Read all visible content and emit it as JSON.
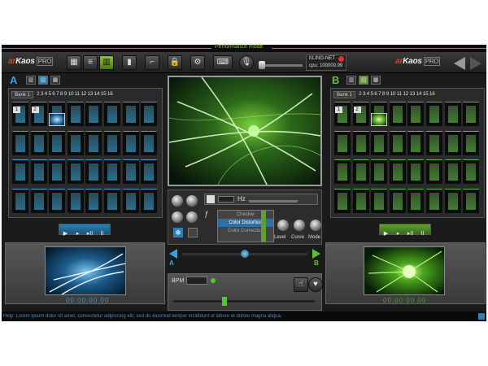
{
  "mode_label": "Performance mode",
  "brand": {
    "ar": "ar",
    "kaos": "Kaos",
    "pro": "PRO"
  },
  "kling": {
    "title": "KLING-NET",
    "cpu": "cpu: 100000.99"
  },
  "deck_a": {
    "letter": "A",
    "bank": "Bank 1",
    "bank_numbers": "2 3 4 5 6 7 8 9 10 11 12 13 14 15 16",
    "cell_numbers": [
      "1",
      "2"
    ],
    "timecode": "00:00:00.00",
    "accent": "#2aa7df"
  },
  "deck_b": {
    "letter": "B",
    "bank": "Bank 1",
    "bank_numbers": "2 3 4 5 6 7 8 9 10 11 12 13 14 15 16",
    "cell_numbers": [
      "1",
      "2"
    ],
    "timecode": "00:00:00.00",
    "accent": "#56c338"
  },
  "fx": {
    "hz_label": "Hz",
    "filters": [
      "Checker",
      "Color Distortion",
      "Color Correction"
    ],
    "selected_filter": "Color Distortion",
    "knobs": [
      "Level",
      "Curve",
      "Mode"
    ]
  },
  "crossfader": {
    "left": "A",
    "right": "B",
    "position": 0.5
  },
  "bpm": {
    "label": "BPM"
  },
  "transport": [
    "▶",
    "▸",
    "▸II",
    "II"
  ],
  "status_text": "Help: Lorem ipsum dolor sit amet, consectetur adipiscing elit, sed do eiusmod tempor incididunt ut labore et dolore magna aliqua."
}
